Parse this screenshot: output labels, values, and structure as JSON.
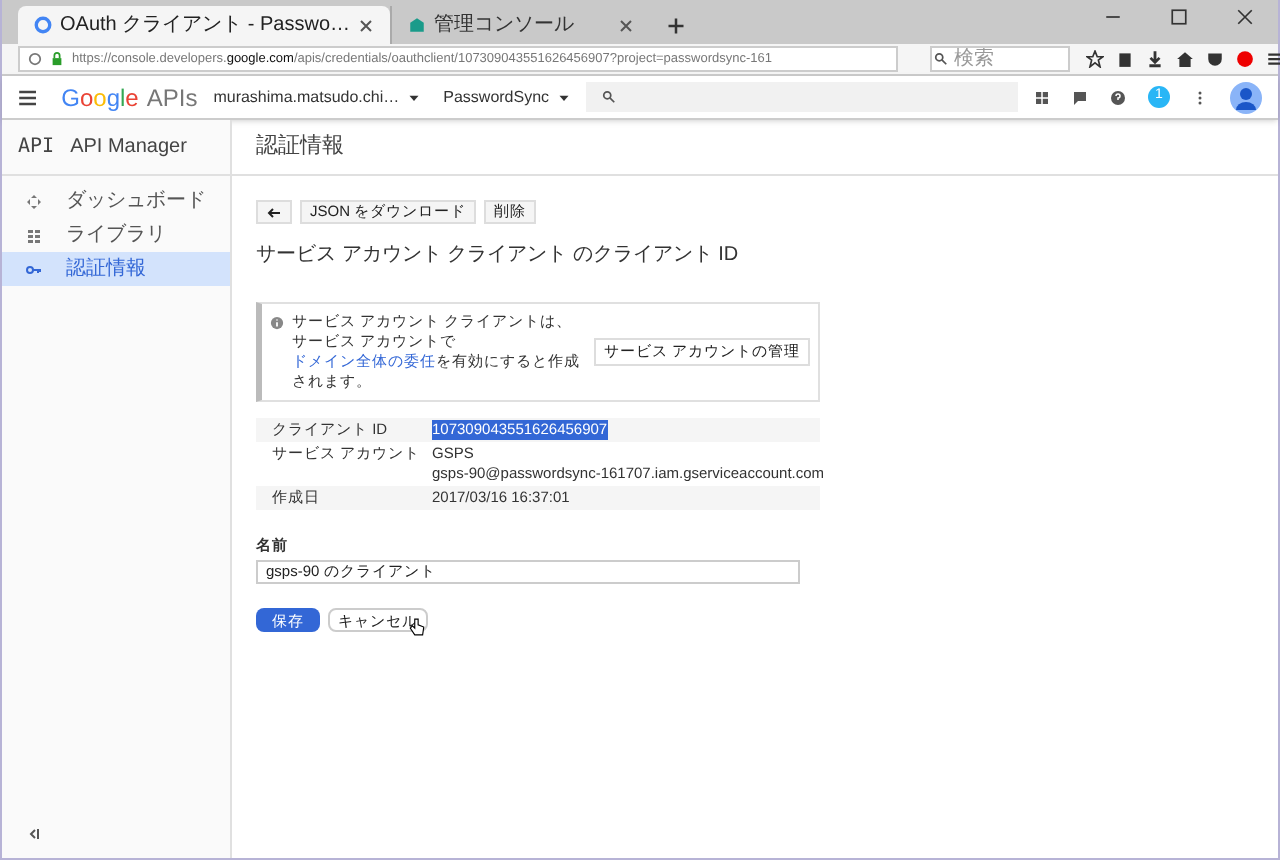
{
  "browser": {
    "tabs": [
      {
        "title": "OAuth クライアント - Passwo…",
        "selected": true
      },
      {
        "title": "管理コンソール",
        "selected": false
      }
    ],
    "url": "https://console.developers.**google.com**/apis/credentials/oauthclient/107309043551626456907?project=passwordsync-161",
    "search": {
      "placeholder": "検索"
    }
  },
  "app_bar": {
    "brand": "Google",
    "brand_suffix": "APIs",
    "account": "murashima.matsudo.chi…",
    "project": "PasswordSync",
    "notification_count": "1"
  },
  "sidebar": {
    "title_logo": "API",
    "title": "API Manager",
    "items": [
      {
        "label": "ダッシュボード",
        "selected": false
      },
      {
        "label": "ライブラリ",
        "selected": false
      },
      {
        "label": "認証情報",
        "selected": true
      }
    ]
  },
  "main": {
    "title": "認証情報",
    "toolbar": [
      "JSON をダウンロード",
      "削除"
    ],
    "heading": "サービス アカウント クライアント のクライアント ID",
    "notice": {
      "text": "サービス アカウント クライアントは、サービス アカウントで",
      "link": "ドメイン全体の委任",
      "text_after": "を有効にすると作成されます。",
      "button": "サービス アカウントの管理"
    },
    "details": [
      {
        "label": "クライアント ID",
        "values": [
          "107309043551626456907"
        ],
        "highlighted": true
      },
      {
        "label": "サービス アカウント",
        "values": [
          "GSPS",
          "gsps-90@passwordsync-161707.iam.gserviceaccount.com"
        ],
        "highlighted": false
      },
      {
        "label": "作成日",
        "values": [
          "2017/03/16 16:37:01"
        ],
        "highlighted": false
      }
    ],
    "name_field": {
      "label": "名前",
      "value": "gsps-90 のクライアント"
    },
    "buttons": [
      {
        "label": "保存",
        "kind": "primary"
      },
      {
        "label": "キャンセル",
        "kind": "secondary"
      }
    ]
  }
}
